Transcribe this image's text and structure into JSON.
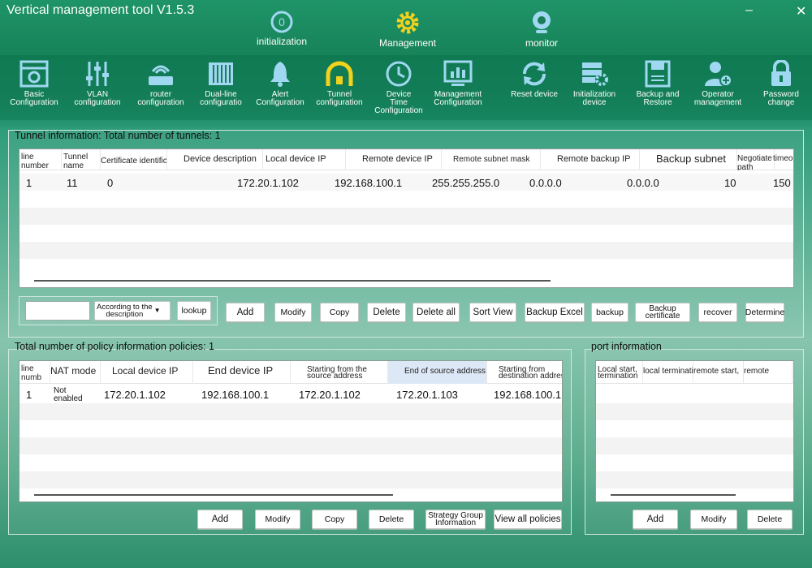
{
  "window": {
    "title": "Vertical management tool V1.5.3",
    "minimize": "–",
    "close": "✕"
  },
  "topnav": [
    {
      "label": "initialization",
      "icon": "initialization-icon"
    },
    {
      "label": "Management",
      "icon": "gear-icon"
    },
    {
      "label": "monitor",
      "icon": "webcam-icon"
    }
  ],
  "toolbar": [
    {
      "label": "Basic\nConfiguration",
      "icon": "basic-config-icon"
    },
    {
      "label": "VLAN\nconfiguration",
      "icon": "vlan-sliders-icon"
    },
    {
      "label": "router\nconfiguration",
      "icon": "router-icon"
    },
    {
      "label": "Dual-line\nconfiguratio",
      "icon": "dual-line-icon"
    },
    {
      "label": "Alert\nConfiguration",
      "icon": "bell-icon"
    },
    {
      "label": "Tunnel\nconfiguration",
      "icon": "tunnel-icon"
    },
    {
      "label": "Device\nTime\nConfiguration",
      "icon": "clock-icon"
    },
    {
      "label": "Management\nConfiguration",
      "icon": "monitor-chart-icon"
    },
    {
      "label": "Reset device",
      "icon": "reset-icon"
    },
    {
      "label": "Initialization\ndevice",
      "icon": "init-device-icon"
    },
    {
      "label": "Backup and\nRestore",
      "icon": "floppy-icon"
    },
    {
      "label": "Operator\nmanagement",
      "icon": "user-add-icon"
    },
    {
      "label": "Password\nchange",
      "icon": "padlock-icon"
    }
  ],
  "tunnel": {
    "title": "Tunnel information: Total number of tunnels: 1",
    "columns": [
      "line\nnumber",
      "Tunnel name\nnu",
      "Certificate identificati",
      "Device description",
      "Local device IP",
      "Remote device IP",
      "Remote subnet mask",
      "Remote backup IP",
      "Backup subnet",
      "Negotiate\npath",
      "timeout"
    ],
    "rows": [
      [
        "1",
        "11",
        "0",
        "",
        "172.20.1.102",
        "192.168.100.1",
        "255.255.255.0",
        "0.0.0.0",
        "0.0.0.0",
        "10",
        "150"
      ]
    ],
    "search_value": "",
    "filter_select": "According to the\ndescription",
    "buttons": [
      "lookup",
      "Add",
      "Modify",
      "Copy",
      "Delete",
      "Delete all",
      "Sort View",
      "Backup Excel",
      "backup",
      "Backup\ncertificate",
      "recover",
      "Determine"
    ]
  },
  "policy": {
    "title": "Total number of policy information policies: 1",
    "columns": [
      "line\nnumb",
      "NAT mode",
      "Local device IP",
      "End device IP",
      "Starting from the\nsource address",
      "End of source address",
      "Starting from\ndestination address"
    ],
    "rows": [
      [
        "1",
        "Not\nenabled",
        "172.20.1.102",
        "192.168.100.1",
        "172.20.1.102",
        "172.20.1.103",
        "192.168.100.1"
      ]
    ],
    "buttons": [
      "Add",
      "Modify",
      "Copy",
      "Delete",
      "Strategy Group\nInformation",
      "View all policies"
    ]
  },
  "port": {
    "title": "port information",
    "columns": [
      "Local start,\ntermination",
      "local termination,",
      "remote start,",
      "remote"
    ],
    "buttons": [
      "Add",
      "Modify",
      "Delete"
    ]
  }
}
